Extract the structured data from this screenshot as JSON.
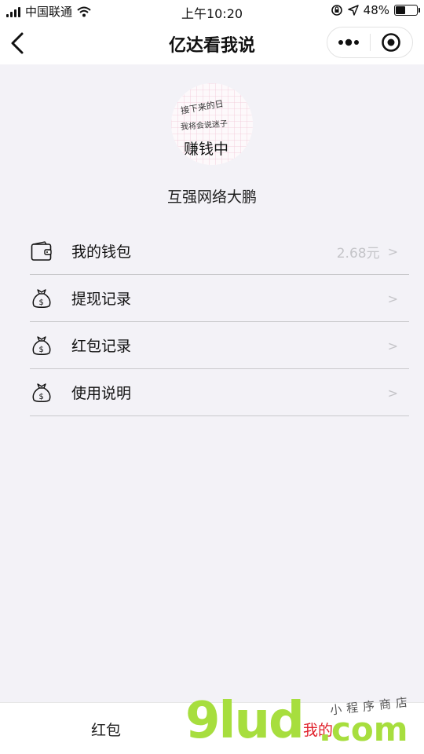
{
  "status_bar": {
    "carrier": "中国联通",
    "time": "上午10:20",
    "battery_percent": "48%",
    "battery_level": 0.48
  },
  "nav": {
    "title": "亿达看我说",
    "back_icon": "chevron-left-icon",
    "more_icon": "more-dots-icon",
    "close_icon": "target-circle-icon"
  },
  "profile": {
    "avatar_lines": [
      "接下来的日",
      "我将会说迷子",
      "赚钱中"
    ],
    "nickname": "互强网络大鹏"
  },
  "menu": {
    "items": [
      {
        "icon": "wallet-icon",
        "label": "我的钱包",
        "value": "2.68元",
        "arrow": ">"
      },
      {
        "icon": "money-bag-icon",
        "label": "提现记录",
        "value": "",
        "arrow": ">"
      },
      {
        "icon": "money-bag-icon",
        "label": "红包记录",
        "value": "",
        "arrow": ">"
      },
      {
        "icon": "money-bag-icon",
        "label": "使用说明",
        "value": "",
        "arrow": ">"
      }
    ]
  },
  "tab_bar": {
    "tabs": [
      {
        "label": "红包",
        "active": false
      },
      {
        "label": "我的",
        "active": true,
        "color": "#e0202a"
      }
    ]
  },
  "watermark": {
    "brand": "9lud",
    "suffix": ".com",
    "tagline": "小程序商店"
  }
}
